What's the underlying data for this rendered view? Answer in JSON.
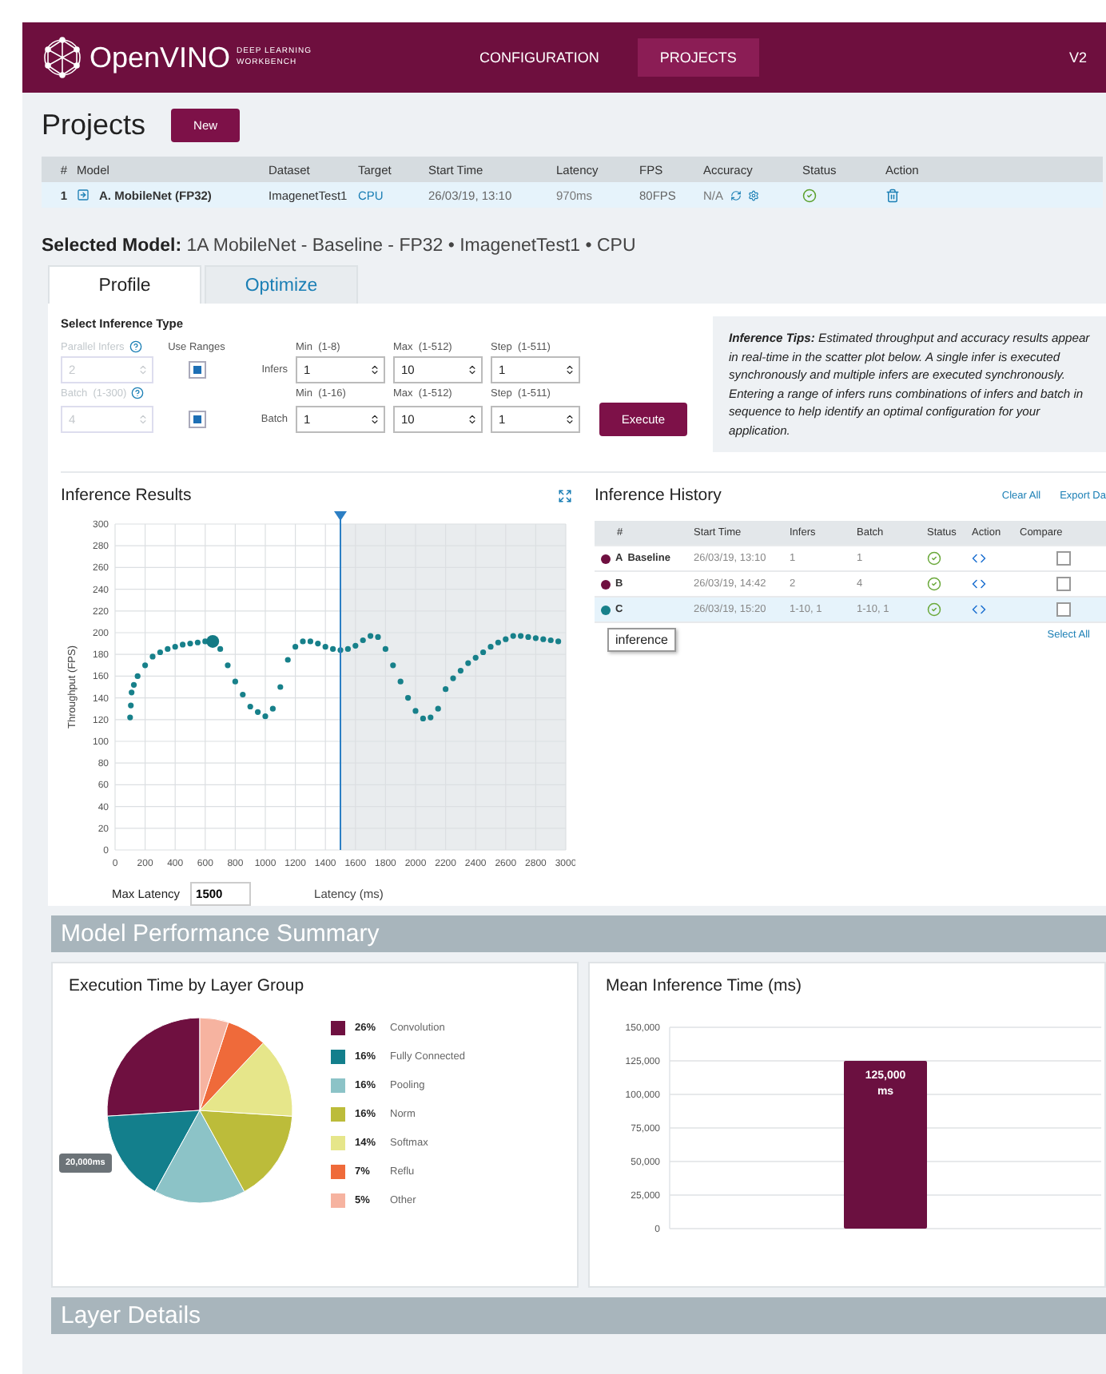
{
  "header": {
    "logo_text": "OpenVINO",
    "logo_sub": [
      "DEEP LEARNING",
      "WORKBENCH"
    ],
    "nav": [
      {
        "label": "CONFIGURATION",
        "selected": false
      },
      {
        "label": "PROJECTS",
        "selected": true
      }
    ],
    "version": "V2"
  },
  "projects": {
    "title": "Projects",
    "new_button": "New",
    "columns": [
      "#",
      "Model",
      "Dataset",
      "Target",
      "Start Time",
      "Latency",
      "FPS",
      "Accuracy",
      "Status",
      "Action"
    ],
    "rows": [
      {
        "number": "1",
        "model": "A. MobileNet (FP32)",
        "dataset": "ImagenetTest1",
        "target": "CPU",
        "start_time": "26/03/19, 13:10",
        "latency": "970ms",
        "fps": "80FPS",
        "accuracy": "N/A",
        "selected": true
      }
    ]
  },
  "selected_model": "**Selected Model:** 1A MobileNet - Baseline - FP32 • ImagenetTest1 • CPU",
  "tabs": [
    {
      "label": "Profile",
      "selected": true
    },
    {
      "label": "Optimize",
      "selected": false
    }
  ],
  "inference_type": {
    "title": "Select Inference Type",
    "use_ranges_label": "Use Ranges",
    "execute_button": "Execute",
    "rows": [
      {
        "label": "Parallel Infers",
        "disabled": true,
        "value": "2",
        "use_ranges": true,
        "name": "Infers",
        "min_label": "Min  (1-8)",
        "min": "1",
        "max_label": "Max  (1-512)",
        "max": "10",
        "step_label": "Step  (1-511)",
        "step": "1"
      },
      {
        "label": "Batch  (1-300)",
        "disabled": true,
        "value": "4",
        "use_ranges": true,
        "name": "Batch",
        "min_label": "Min  (1-16)",
        "min": "1",
        "max_label": "Max  (1-512)",
        "max": "10",
        "step_label": "Step  (1-511)",
        "step": "1"
      }
    ]
  },
  "tips": "**Inference Tips:** Estimated throughput and accuracy results appear in real-time in the scatter plot below.  A single infer is executed synchronously and multiple infers are executed synchronously.   Entering a range of infers runs combinations of infers and batch in sequence to help identify an optimal configuration for your application.",
  "inference_results": {
    "title": "Inference Results",
    "max_latency_label": "Max Latency",
    "max_latency": "1500",
    "chart_data": {
      "type": "scatter",
      "xlabel": "Latency (ms)",
      "ylabel": "Throughput (FPS)",
      "xlim": [
        0,
        3000
      ],
      "ylim": [
        0,
        300
      ],
      "grid": true,
      "xticks": [
        0,
        200,
        400,
        600,
        800,
        1000,
        1200,
        1400,
        1600,
        1800,
        2000,
        2200,
        2400,
        2600,
        2800,
        3000
      ],
      "yticks": [
        0,
        20,
        40,
        60,
        80,
        100,
        120,
        140,
        160,
        180,
        200,
        220,
        240,
        260,
        280,
        300
      ],
      "x": [
        100,
        105,
        110,
        125,
        150,
        200,
        250,
        300,
        350,
        400,
        450,
        500,
        550,
        600,
        650,
        700,
        750,
        800,
        850,
        900,
        950,
        1000,
        1050,
        1100,
        1150,
        1200,
        1250,
        1300,
        1350,
        1400,
        1450,
        1500,
        1550,
        1600,
        1650,
        1700,
        1750,
        1800,
        1850,
        1900,
        1950,
        2000,
        2050,
        2100,
        2150,
        2200,
        2250,
        2300,
        2350,
        2400,
        2450,
        2500,
        2550,
        2600,
        2650,
        2700,
        2750,
        2800,
        2850,
        2900,
        2950
      ],
      "series": [
        {
          "color": "#17808a",
          "values": [
            122,
            133,
            145,
            152,
            160,
            170,
            178,
            182,
            185,
            187,
            189,
            190,
            191,
            192,
            null,
            185,
            170,
            155,
            143,
            132,
            127,
            123,
            130,
            150,
            175,
            187,
            192,
            192,
            190,
            187,
            185,
            184,
            185,
            188,
            193,
            197,
            196,
            185,
            170,
            155,
            140,
            128,
            121,
            122,
            130,
            148,
            158,
            165,
            172,
            177,
            182,
            187,
            191,
            194,
            197,
            197,
            196,
            195,
            194,
            193,
            192
          ]
        },
        {
          "color": "#137a85",
          "values": [
            null,
            null,
            null,
            null,
            null,
            null,
            null,
            null,
            null,
            null,
            null,
            null,
            null,
            null,
            192,
            null,
            null,
            null,
            null,
            null,
            null,
            null,
            null,
            null,
            null,
            null,
            null,
            null,
            null,
            null,
            null,
            null,
            null,
            null,
            null,
            null,
            null,
            null,
            null,
            null,
            null,
            null,
            null,
            null,
            null,
            null,
            null,
            null,
            null,
            null,
            null,
            null,
            null,
            null,
            null,
            null,
            null,
            null,
            null,
            null,
            null
          ]
        }
      ],
      "ref_lines": [
        {
          "axis": "x",
          "value": 1500
        }
      ]
    }
  },
  "inference_history": {
    "title": "Inference History",
    "clear_all": "Clear All",
    "export": "Export Da",
    "columns": [
      "#",
      "Start Time",
      "Infers",
      "Batch",
      "Status",
      "Action",
      "Compare"
    ],
    "rows": [
      {
        "id": "A",
        "name": "Baseline",
        "color": "#6f1040",
        "start_time": "26/03/19, 13:10",
        "infers": "1",
        "batch": "1",
        "selected": false,
        "compare": false
      },
      {
        "id": "B",
        "name": "",
        "color": "#6f1040",
        "start_time": "26/03/19, 14:42",
        "infers": "2",
        "batch": "4",
        "selected": false,
        "compare": false
      },
      {
        "id": "C",
        "name": "",
        "color": "#17808a",
        "start_time": "26/03/19, 15:20",
        "infers": "1-10, 1",
        "batch": "1-10, 1",
        "selected": true,
        "compare": false
      }
    ],
    "tooltip": "inference",
    "select_all": "Select All"
  },
  "summary": {
    "title": "Model Performance Summary",
    "layer_group": {
      "title": "Execution Time by Layer Group",
      "tooltip": "20,000ms",
      "legend": [
        {
          "percent": "26%",
          "color": "#6f1040"
        },
        {
          "percent": "16%",
          "color": "#137f8c"
        },
        {
          "percent": "16%",
          "color": "#8cc3c7"
        },
        {
          "percent": "16%",
          "color": "#bcbc3a"
        },
        {
          "percent": "14%",
          "color": "#e6e68a"
        },
        {
          "percent": "7%",
          "color": "#ef6a3a"
        },
        {
          "percent": "5%",
          "color": "#f6b3a0"
        }
      ],
      "chart_data": {
        "type": "pie",
        "categories": [
          "Convolution",
          "Fully Connected",
          "Pooling",
          "Norm",
          "Softmax",
          "Reflu",
          "Other"
        ],
        "values": [
          26,
          16,
          16,
          16,
          14,
          7,
          5
        ]
      }
    },
    "mean_time": {
      "title": "Mean Inference Time (ms)",
      "chart_data": {
        "type": "bar",
        "series": [
          {
            "color": "#6b1040",
            "values": [
              125000
            ]
          }
        ],
        "ylim": [
          0,
          150000
        ],
        "grid": true,
        "yticks": [
          {
            "value": 0,
            "label": "0"
          },
          {
            "value": 25000,
            "label": "25,000"
          },
          {
            "value": 50000,
            "label": "50,000"
          },
          {
            "value": 75000,
            "label": "75,000"
          },
          {
            "value": 100000,
            "label": "100,000"
          },
          {
            "value": 125000,
            "label": "125,000"
          },
          {
            "value": 150000,
            "label": "150,000"
          }
        ],
        "value_labels": [
          "125,000 ms"
        ]
      }
    }
  },
  "layer_details": {
    "title": "Layer Details"
  }
}
